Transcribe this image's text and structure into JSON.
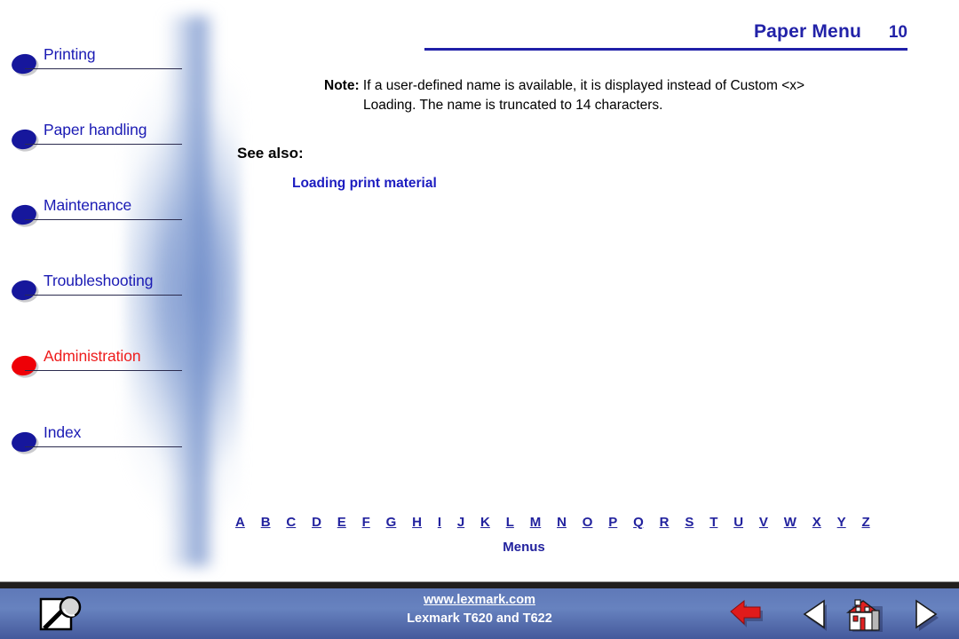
{
  "header": {
    "title": "Paper Menu",
    "page_number": "10",
    "rule_color": "#2020a8"
  },
  "sidebar": {
    "items": [
      {
        "label": "Printing",
        "color": "#1b1bb4",
        "bullet": "blue",
        "bullet_color": "#16179c"
      },
      {
        "label": "Paper handling",
        "color": "#1b1bb4",
        "bullet": "blue",
        "bullet_color": "#16179c"
      },
      {
        "label": "Maintenance",
        "color": "#1b1bb4",
        "bullet": "blue",
        "bullet_color": "#16179c"
      },
      {
        "label": "Troubleshooting",
        "color": "#1b1bb4",
        "bullet": "blue",
        "bullet_color": "#16179c"
      },
      {
        "label": "Administration",
        "color": "#ee1c1c",
        "bullet": "red",
        "bullet_color": "#ee0007"
      },
      {
        "label": "Index",
        "color": "#1b1bb4",
        "bullet": "blue",
        "bullet_color": "#16179c"
      }
    ]
  },
  "main": {
    "note": {
      "label": "Note:",
      "line1": "If a user-defined name is available, it is displayed instead of Custom <x>",
      "line2": "Loading. The name is truncated to 14 characters."
    },
    "see_also_heading": "See also:",
    "see_also_links": [
      {
        "label": "Loading print material",
        "color": "#1c1cc0"
      }
    ]
  },
  "index_bar": {
    "letters": [
      "A",
      "B",
      "C",
      "D",
      "E",
      "F",
      "G",
      "H",
      "I",
      "J",
      "K",
      "L",
      "M",
      "N",
      "O",
      "P",
      "Q",
      "R",
      "S",
      "T",
      "U",
      "V",
      "W",
      "X",
      "Y",
      "Z"
    ],
    "menus_label": "Menus",
    "link_color": "#22229e"
  },
  "footer": {
    "url": "www.lexmark.com",
    "model": "Lexmark T620 and T622",
    "background_color": "#5f79b8",
    "buttons": [
      {
        "name": "back-arrow",
        "icon": "left-arrow-icon",
        "color": "#e01b1b"
      },
      {
        "name": "previous",
        "icon": "left-triangle-icon",
        "color": "#ffffff"
      },
      {
        "name": "home",
        "icon": "house-icon",
        "color": "#e02020"
      },
      {
        "name": "next",
        "icon": "right-triangle-icon",
        "color": "#ffffff"
      }
    ],
    "search_icon": "magnifier-page-icon"
  }
}
